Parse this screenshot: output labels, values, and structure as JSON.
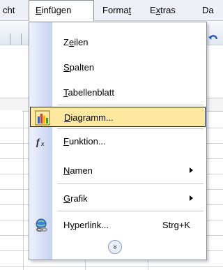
{
  "menubar": {
    "items": [
      {
        "key": "ansicht",
        "text": "cht"
      },
      {
        "key": "einfuegen",
        "pre": "",
        "ul": "E",
        "post": "infügen"
      },
      {
        "key": "format",
        "pre": "Forma",
        "ul": "t",
        "post": ""
      },
      {
        "key": "extras",
        "pre": "E",
        "ul": "x",
        "post": "tras"
      },
      {
        "key": "daten",
        "text": "Da"
      }
    ]
  },
  "menu": {
    "items": [
      {
        "pre": "Z",
        "ul": "e",
        "post": "ilen",
        "icon": "",
        "submenu": false
      },
      {
        "pre": "",
        "ul": "S",
        "post": "palten",
        "icon": "",
        "submenu": false
      },
      {
        "pre": "",
        "ul": "T",
        "post": "abellenblatt",
        "icon": "",
        "submenu": false
      },
      {
        "pre": "",
        "ul": "D",
        "post": "iagramm...",
        "icon": "chart-icon",
        "submenu": false,
        "highlighted": true
      },
      {
        "pre": "",
        "ul": "F",
        "post": "unktion...",
        "icon": "function-icon",
        "submenu": false
      },
      {
        "pre": "",
        "ul": "N",
        "post": "amen",
        "icon": "",
        "submenu": true
      },
      {
        "pre": "",
        "ul": "G",
        "post": "rafik",
        "icon": "",
        "submenu": true
      },
      {
        "pre": "H",
        "ul": "y",
        "post": "perlink...",
        "icon": "hyperlink-icon",
        "shortcut": "Strg+K",
        "submenu": false
      }
    ],
    "expand_icon": "chevron-double-down-icon",
    "expand_glyph": "»"
  },
  "colors": {
    "highlight": "#fde8a0",
    "highlight_border": "#0a246a",
    "menubar": "#eef0f7",
    "rail": "#c7d2ee"
  }
}
